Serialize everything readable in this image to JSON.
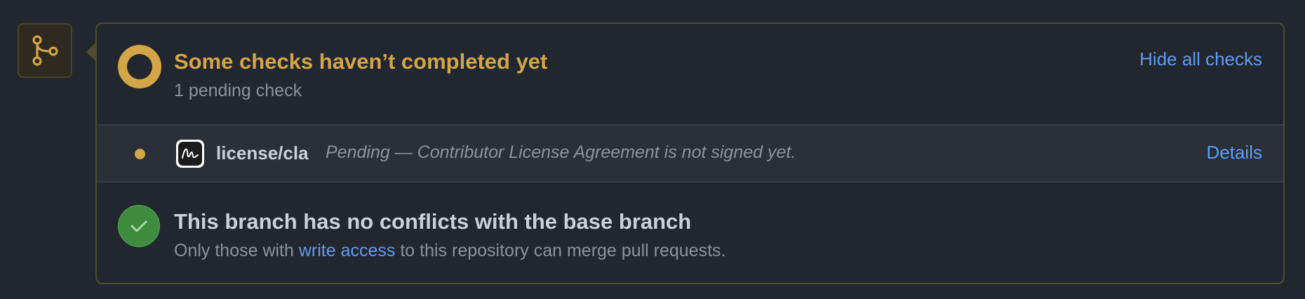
{
  "icons": {
    "merge_badge": "git-branch-icon",
    "pending": "pending-ring-icon",
    "check_status": "pending-dot-icon",
    "app_logo": "cla-assistant-logo",
    "success": "check-icon"
  },
  "colors": {
    "pending": "#d4a546",
    "success": "#3f8b40",
    "link": "#5f9cf0"
  },
  "checks": {
    "title": "Some checks haven’t completed yet",
    "subtitle": "1 pending check",
    "toggle_label": "Hide all checks",
    "items": [
      {
        "name": "license/cla",
        "description": "Pending — Contributor License Agreement is not signed yet.",
        "details_label": "Details",
        "status": "pending"
      }
    ]
  },
  "conflicts": {
    "title": "This branch has no conflicts with the base branch",
    "text_before": "Only those with ",
    "link_label": "write access",
    "text_after": " to this repository can merge pull requests."
  }
}
